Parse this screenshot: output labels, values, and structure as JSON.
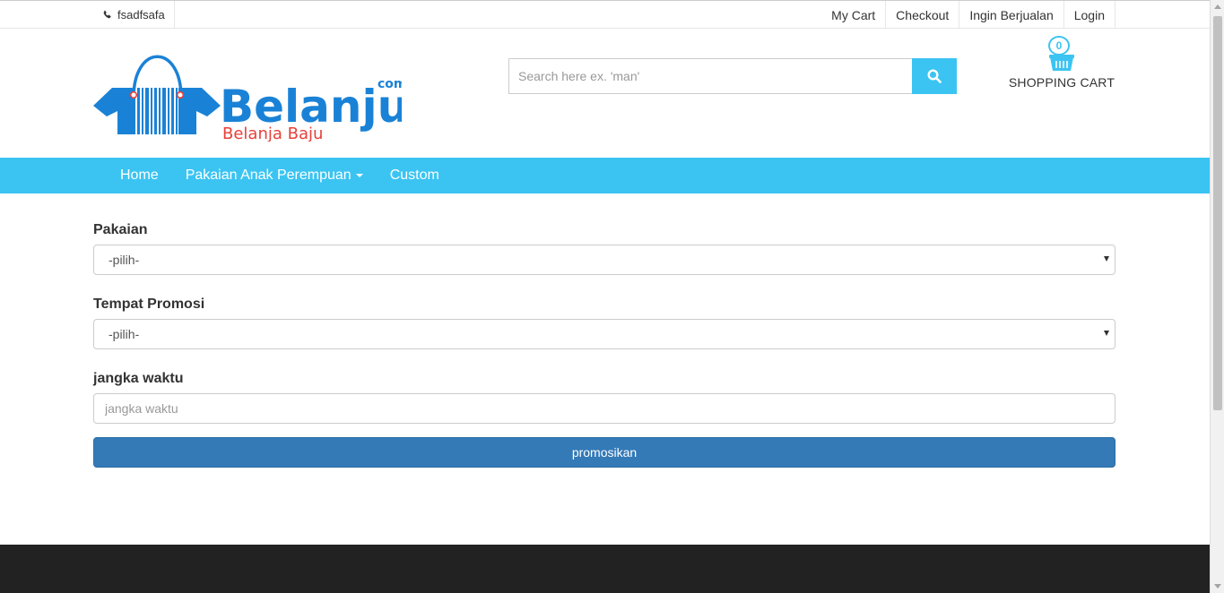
{
  "topbar": {
    "phone_icon": "phone-icon",
    "phone": "fsadfsafa",
    "links": [
      "My Cart",
      "Checkout",
      "Ingin Berjualan",
      "Login"
    ]
  },
  "logo": {
    "name": "Belanju",
    "tld": "com",
    "tagline": "Belanja Baju"
  },
  "search": {
    "placeholder": "Search here ex. 'man'",
    "button_icon": "search-icon"
  },
  "cart": {
    "count": "0",
    "label": "SHOPPING CART",
    "icon": "basket-icon"
  },
  "nav": {
    "items": [
      "Home",
      "Pakaian Anak Perempuan",
      "Custom"
    ]
  },
  "form": {
    "pakaian_label": "Pakaian",
    "pakaian_value": "-pilih-",
    "tempat_label": "Tempat Promosi",
    "tempat_value": "-pilih-",
    "jangka_label": "jangka waktu",
    "jangka_placeholder": "jangka waktu",
    "submit_label": "promosikan"
  },
  "colors": {
    "accent": "#3bc4f2",
    "primary": "#337ab7",
    "logo_blue": "#1a82d6",
    "logo_red": "#e8403a",
    "footer": "#222222"
  }
}
